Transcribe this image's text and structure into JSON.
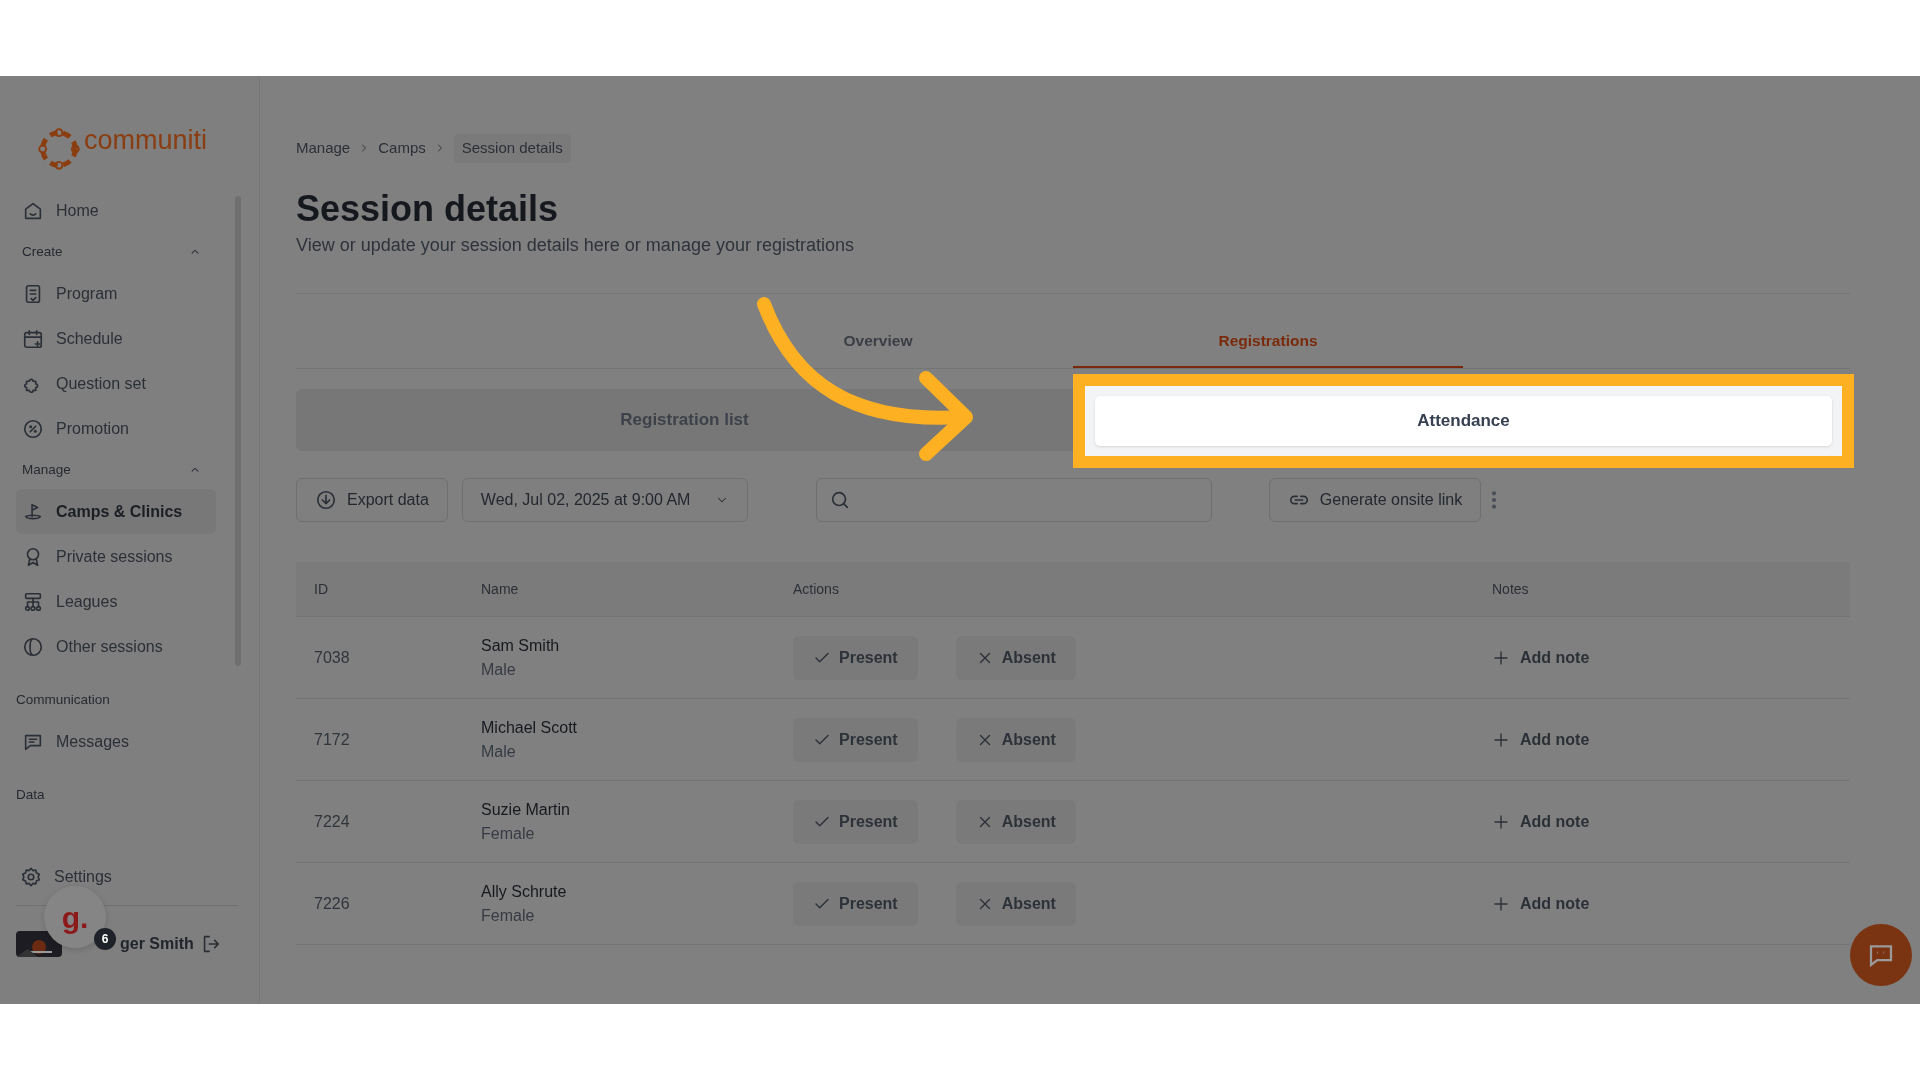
{
  "logo": {
    "text": "communiti"
  },
  "sidebar": {
    "items": [
      {
        "kind": "item",
        "label": "Home",
        "selected": false
      },
      {
        "kind": "group",
        "label": "Create",
        "expanded": true
      },
      {
        "kind": "item",
        "label": "Program",
        "selected": false
      },
      {
        "kind": "item",
        "label": "Schedule",
        "selected": false
      },
      {
        "kind": "item",
        "label": "Question set",
        "selected": false
      },
      {
        "kind": "item",
        "label": "Promotion",
        "selected": false
      },
      {
        "kind": "group",
        "label": "Manage",
        "expanded": true
      },
      {
        "kind": "item",
        "label": "Camps & Clinics",
        "selected": true
      },
      {
        "kind": "item",
        "label": "Private sessions",
        "selected": false
      },
      {
        "kind": "item",
        "label": "Leagues",
        "selected": false
      },
      {
        "kind": "item",
        "label": "Other sessions",
        "selected": false
      },
      {
        "kind": "heading",
        "label": "Communication"
      },
      {
        "kind": "item",
        "label": "Messages",
        "selected": false
      },
      {
        "kind": "heading",
        "label": "Data"
      }
    ],
    "settings": "Settings",
    "user": {
      "name": "ger Smith",
      "badge": "6",
      "widget": "g."
    }
  },
  "breadcrumb": [
    {
      "label": "Manage",
      "current": false
    },
    {
      "label": "Camps",
      "current": false
    },
    {
      "label": "Session details",
      "current": true
    }
  ],
  "page": {
    "title": "Session details",
    "subtitle": "View or update your session details here or manage your registrations"
  },
  "tabs": [
    {
      "label": "Overview",
      "selected": false
    },
    {
      "label": "Registrations",
      "selected": true
    }
  ],
  "segments": [
    {
      "label": "Registration list",
      "selected": false,
      "highlighted": false
    },
    {
      "label": "Attendance",
      "selected": true,
      "highlighted": true
    }
  ],
  "toolbar": {
    "export": "Export data",
    "date": "Wed, Jul 02, 2025 at 9:00 AM",
    "generate": "Generate onsite link"
  },
  "table": {
    "columns": [
      "ID",
      "Name",
      "Actions",
      "Notes"
    ],
    "rows": [
      {
        "id": "7038",
        "name": "Sam Smith",
        "gender": "Male",
        "present": "Present",
        "absent": "Absent",
        "note": "Add note"
      },
      {
        "id": "7172",
        "name": "Michael Scott",
        "gender": "Male",
        "present": "Present",
        "absent": "Absent",
        "note": "Add note"
      },
      {
        "id": "7224",
        "name": "Suzie Martin",
        "gender": "Female",
        "present": "Present",
        "absent": "Absent",
        "note": "Add note"
      },
      {
        "id": "7226",
        "name": "Ally Schrute",
        "gender": "Female",
        "present": "Present",
        "absent": "Absent",
        "note": "Add note"
      }
    ]
  }
}
